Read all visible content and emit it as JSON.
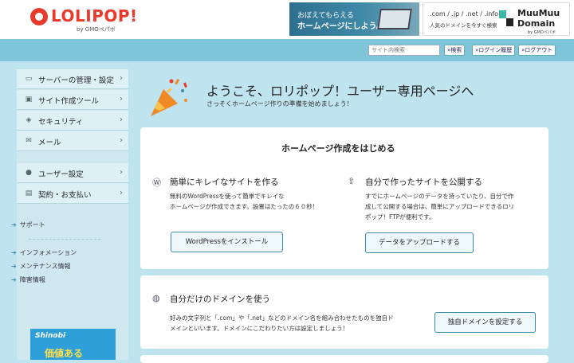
{
  "header": {
    "logo_text": "LOLIPOP!",
    "logo_sub": "by GMOペパボ",
    "banner1": {
      "line1": "おぼえてもらえる",
      "line2": "ホームページにしよう。"
    },
    "banner2": {
      "line1": ".com / .jp / .net / .info",
      "line2": "人気のドメインを今すぐ検索",
      "brand1": "MuuMuu",
      "brand2": "Domain",
      "brand3": "by GMOペパボ"
    }
  },
  "topbar": {
    "search_placeholder": "サイト内検索",
    "search_button": "»検索",
    "history_button": "»ログイン履歴",
    "logout_button": "»ログアウト"
  },
  "sidebar": {
    "items": [
      {
        "label": "サーバーの管理・設定",
        "icon": "server-icon"
      },
      {
        "label": "サイト作成ツール",
        "icon": "monitor-icon"
      },
      {
        "label": "セキュリティ",
        "icon": "shield-icon"
      },
      {
        "label": "メール",
        "icon": "mail-icon"
      },
      {
        "label": "ユーザー設定",
        "icon": "user-icon"
      },
      {
        "label": "契約・お支払い",
        "icon": "card-icon"
      }
    ],
    "support": "サポート",
    "links": [
      "インフォメーション",
      "メンテナンス情報",
      "障害情報"
    ],
    "banner": {
      "line1": "Shinobi",
      "line2": "価値ある"
    }
  },
  "welcome": {
    "title": "ようこそ、ロリポップ！ユーザー専用ページへ",
    "subtitle": "さっそくホームページ作りの準備を始めましょう！"
  },
  "start_card": {
    "title": "ホームページ作成をはじめる",
    "left": {
      "title": "簡単にキレイなサイトを作る",
      "desc1": "無料のWordPressを使って簡単でキレイな",
      "desc2": "ホームページが作成できます。設置はたったの６０秒！",
      "button": "WordPressをインストール"
    },
    "right": {
      "title": "自分で作ったサイトを公開する",
      "desc1": "すでにホームページのデータを持っていたり、自分で作",
      "desc2": "成して公開する場合は、簡単にアップロードできるロリ",
      "desc3": "ポップ！FTPが便利です。",
      "button": "データをアップロードする"
    }
  },
  "domain_card": {
    "title": "自分だけのドメインを使う",
    "desc1": "好みの文字列と「.com」や「.net」などのドメイン名を組み合わせたものを独自ド",
    "desc2": "メインといいます。ドメインにこだわりたい方は設定しましょう！",
    "button": "独自ドメインを設定する"
  },
  "colors": {
    "brand_red": "#e8392b",
    "accent_blue": "#3a8aa8",
    "background": "#bfe3ef",
    "topbar": "#7fc5d9"
  }
}
